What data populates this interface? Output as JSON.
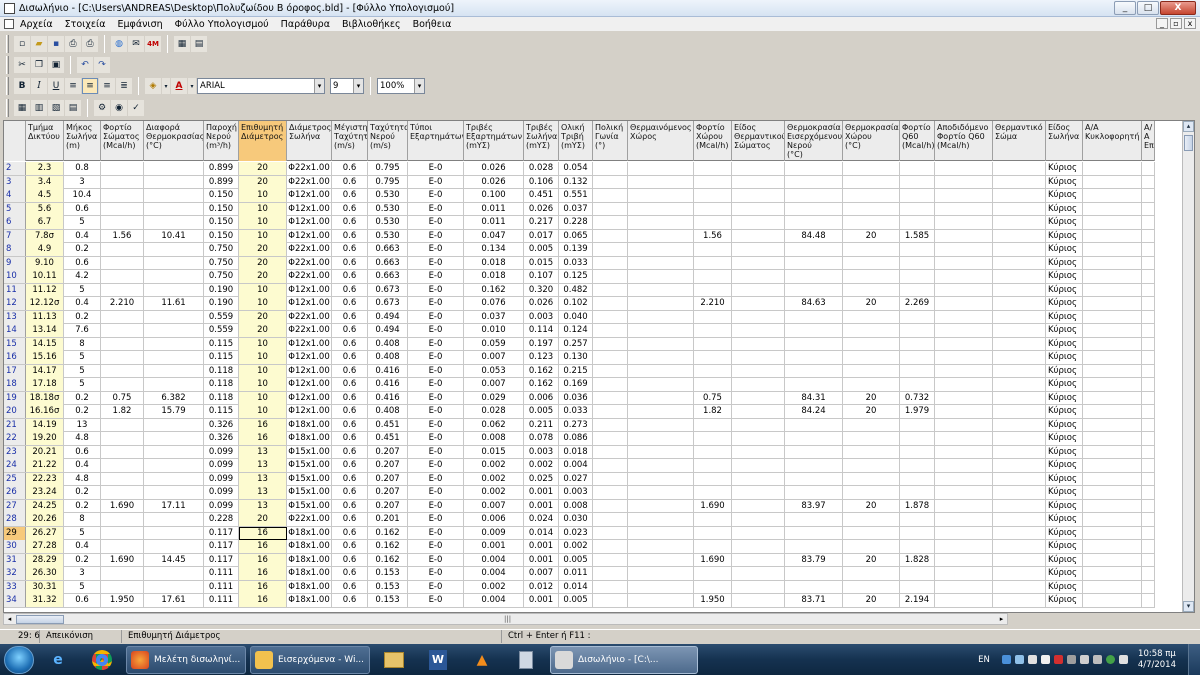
{
  "window": {
    "title": "Δισωλήνιο - [C:\\Users\\ANDREAS\\Desktop\\Πολυζωίδου Β όροφος.bld] - [Φύλλο Υπολογισμού]",
    "minimize_label": "_",
    "maximize_label": "□",
    "close_label": "X"
  },
  "menu": {
    "items": [
      "Αρχεία",
      "Στοιχεία",
      "Εμφάνιση",
      "Φύλλο Υπολογισμού",
      "Παράθυρα",
      "Βιβλιοθήκες",
      "Βοήθεια"
    ]
  },
  "format_toolbar": {
    "bold_label": "B",
    "italic_label": "I",
    "underline_label": "U",
    "font_value": "ARIAL",
    "size_value": "9",
    "zoom_value": "100%",
    "font_color_label": "A"
  },
  "grid": {
    "selected_column": "Επιθυμητή Διάμετρος",
    "current_cell": {
      "row": "29",
      "col": "Επιθυμητή Διάμετρος"
    },
    "columns": [
      "Τμήμα\nΔικτύου",
      "Μήκος\nΣωλήνα\n(m)",
      "Φορτίο\nΣώματος\n(Mcal/h)",
      "Διαφορά\nΘερμοκρασίας\n(°C)",
      "Παροχή\nΝερού\n(m³/h)",
      "Επιθυμητή\nΔιάμετρος",
      "Διάμετρος\nΣωλήνα",
      "Μέγιστη\nΤαχύτητα\n(m/s)",
      "Ταχύτητα\nΝερού\n(m/s)",
      "Τύποι\nΕξαρτημάτων",
      "Τριβές\nΕξαρτημάτων\n(mΥΣ)",
      "Τριβές\nΣωλήνα\n(mΥΣ)",
      "Ολική\nΤριβή\n(mΥΣ)",
      "Πολική\nΓωνία\n(°)",
      "Θερμαινόμενος\nΧώρος",
      "Φορτίο\nΧώρου\n(Mcal/h)",
      "Είδος\nΘερμαντικού\nΣώματος",
      "Θερμοκρασία\nΕισερχόμενου\nΝερού\n(°C)",
      "Θερμοκρασία\nΧώρου\n(°C)",
      "Φορτίο\nQ60\n(Mcal/h)",
      "Αποδιδόμενο\nΦορτίο Q60\n(Mcal/h)",
      "Θερμαντικό\nΣώμα",
      "Είδος\nΣωλήνα",
      "Α/Α\nΚυκλοφορητή",
      "Α/Α\nΕπ"
    ],
    "rows": [
      {
        "n": "2",
        "d": [
          "2.3",
          "0.8",
          "",
          "",
          "0.899",
          "20",
          "Φ22x1.00",
          "0.6",
          "0.795",
          "E-0",
          "0.026",
          "0.028",
          "0.054",
          "",
          "",
          "",
          "",
          "",
          "",
          "",
          "",
          "",
          "Κύριος",
          "",
          ""
        ]
      },
      {
        "n": "3",
        "d": [
          "3.4",
          "3",
          "",
          "",
          "0.899",
          "20",
          "Φ22x1.00",
          "0.6",
          "0.795",
          "E-0",
          "0.026",
          "0.106",
          "0.132",
          "",
          "",
          "",
          "",
          "",
          "",
          "",
          "",
          "",
          "Κύριος",
          "",
          ""
        ]
      },
      {
        "n": "4",
        "d": [
          "4.5",
          "10.4",
          "",
          "",
          "0.150",
          "10",
          "Φ12x1.00",
          "0.6",
          "0.530",
          "E-0",
          "0.100",
          "0.451",
          "0.551",
          "",
          "",
          "",
          "",
          "",
          "",
          "",
          "",
          "",
          "Κύριος",
          "",
          ""
        ]
      },
      {
        "n": "5",
        "d": [
          "5.6",
          "0.6",
          "",
          "",
          "0.150",
          "10",
          "Φ12x1.00",
          "0.6",
          "0.530",
          "E-0",
          "0.011",
          "0.026",
          "0.037",
          "",
          "",
          "",
          "",
          "",
          "",
          "",
          "",
          "",
          "Κύριος",
          "",
          ""
        ]
      },
      {
        "n": "6",
        "d": [
          "6.7",
          "5",
          "",
          "",
          "0.150",
          "10",
          "Φ12x1.00",
          "0.6",
          "0.530",
          "E-0",
          "0.011",
          "0.217",
          "0.228",
          "",
          "",
          "",
          "",
          "",
          "",
          "",
          "",
          "",
          "Κύριος",
          "",
          ""
        ]
      },
      {
        "n": "7",
        "d": [
          "7.8σ",
          "0.4",
          "1.56",
          "10.41",
          "0.150",
          "10",
          "Φ12x1.00",
          "0.6",
          "0.530",
          "E-0",
          "0.047",
          "0.017",
          "0.065",
          "",
          "",
          "1.56",
          "",
          "84.48",
          "20",
          "1.585",
          "",
          "",
          "Κύριος",
          "",
          ""
        ]
      },
      {
        "n": "8",
        "d": [
          "4.9",
          "0.2",
          "",
          "",
          "0.750",
          "20",
          "Φ22x1.00",
          "0.6",
          "0.663",
          "E-0",
          "0.134",
          "0.005",
          "0.139",
          "",
          "",
          "",
          "",
          "",
          "",
          "",
          "",
          "",
          "Κύριος",
          "",
          ""
        ]
      },
      {
        "n": "9",
        "d": [
          "9.10",
          "0.6",
          "",
          "",
          "0.750",
          "20",
          "Φ22x1.00",
          "0.6",
          "0.663",
          "E-0",
          "0.018",
          "0.015",
          "0.033",
          "",
          "",
          "",
          "",
          "",
          "",
          "",
          "",
          "",
          "Κύριος",
          "",
          ""
        ]
      },
      {
        "n": "10",
        "d": [
          "10.11",
          "4.2",
          "",
          "",
          "0.750",
          "20",
          "Φ22x1.00",
          "0.6",
          "0.663",
          "E-0",
          "0.018",
          "0.107",
          "0.125",
          "",
          "",
          "",
          "",
          "",
          "",
          "",
          "",
          "",
          "Κύριος",
          "",
          ""
        ]
      },
      {
        "n": "11",
        "d": [
          "11.12",
          "5",
          "",
          "",
          "0.190",
          "10",
          "Φ12x1.00",
          "0.6",
          "0.673",
          "E-0",
          "0.162",
          "0.320",
          "0.482",
          "",
          "",
          "",
          "",
          "",
          "",
          "",
          "",
          "",
          "Κύριος",
          "",
          ""
        ]
      },
      {
        "n": "12",
        "d": [
          "12.12σ",
          "0.4",
          "2.210",
          "11.61",
          "0.190",
          "10",
          "Φ12x1.00",
          "0.6",
          "0.673",
          "E-0",
          "0.076",
          "0.026",
          "0.102",
          "",
          "",
          "2.210",
          "",
          "84.63",
          "20",
          "2.269",
          "",
          "",
          "Κύριος",
          "",
          ""
        ]
      },
      {
        "n": "13",
        "d": [
          "11.13",
          "0.2",
          "",
          "",
          "0.559",
          "20",
          "Φ22x1.00",
          "0.6",
          "0.494",
          "E-0",
          "0.037",
          "0.003",
          "0.040",
          "",
          "",
          "",
          "",
          "",
          "",
          "",
          "",
          "",
          "Κύριος",
          "",
          ""
        ]
      },
      {
        "n": "14",
        "d": [
          "13.14",
          "7.6",
          "",
          "",
          "0.559",
          "20",
          "Φ22x1.00",
          "0.6",
          "0.494",
          "E-0",
          "0.010",
          "0.114",
          "0.124",
          "",
          "",
          "",
          "",
          "",
          "",
          "",
          "",
          "",
          "Κύριος",
          "",
          ""
        ]
      },
      {
        "n": "15",
        "d": [
          "14.15",
          "8",
          "",
          "",
          "0.115",
          "10",
          "Φ12x1.00",
          "0.6",
          "0.408",
          "E-0",
          "0.059",
          "0.197",
          "0.257",
          "",
          "",
          "",
          "",
          "",
          "",
          "",
          "",
          "",
          "Κύριος",
          "",
          ""
        ]
      },
      {
        "n": "16",
        "d": [
          "15.16",
          "5",
          "",
          "",
          "0.115",
          "10",
          "Φ12x1.00",
          "0.6",
          "0.408",
          "E-0",
          "0.007",
          "0.123",
          "0.130",
          "",
          "",
          "",
          "",
          "",
          "",
          "",
          "",
          "",
          "Κύριος",
          "",
          ""
        ]
      },
      {
        "n": "17",
        "d": [
          "14.17",
          "5",
          "",
          "",
          "0.118",
          "10",
          "Φ12x1.00",
          "0.6",
          "0.416",
          "E-0",
          "0.053",
          "0.162",
          "0.215",
          "",
          "",
          "",
          "",
          "",
          "",
          "",
          "",
          "",
          "Κύριος",
          "",
          ""
        ]
      },
      {
        "n": "18",
        "d": [
          "17.18",
          "5",
          "",
          "",
          "0.118",
          "10",
          "Φ12x1.00",
          "0.6",
          "0.416",
          "E-0",
          "0.007",
          "0.162",
          "0.169",
          "",
          "",
          "",
          "",
          "",
          "",
          "",
          "",
          "",
          "Κύριος",
          "",
          ""
        ]
      },
      {
        "n": "19",
        "d": [
          "18.18σ",
          "0.2",
          "0.75",
          "6.382",
          "0.118",
          "10",
          "Φ12x1.00",
          "0.6",
          "0.416",
          "E-0",
          "0.029",
          "0.006",
          "0.036",
          "",
          "",
          "0.75",
          "",
          "84.31",
          "20",
          "0.732",
          "",
          "",
          "Κύριος",
          "",
          ""
        ]
      },
      {
        "n": "20",
        "d": [
          "16.16σ",
          "0.2",
          "1.82",
          "15.79",
          "0.115",
          "10",
          "Φ12x1.00",
          "0.6",
          "0.408",
          "E-0",
          "0.028",
          "0.005",
          "0.033",
          "",
          "",
          "1.82",
          "",
          "84.24",
          "20",
          "1.979",
          "",
          "",
          "Κύριος",
          "",
          ""
        ]
      },
      {
        "n": "21",
        "d": [
          "14.19",
          "13",
          "",
          "",
          "0.326",
          "16",
          "Φ18x1.00",
          "0.6",
          "0.451",
          "E-0",
          "0.062",
          "0.211",
          "0.273",
          "",
          "",
          "",
          "",
          "",
          "",
          "",
          "",
          "",
          "Κύριος",
          "",
          ""
        ]
      },
      {
        "n": "22",
        "d": [
          "19.20",
          "4.8",
          "",
          "",
          "0.326",
          "16",
          "Φ18x1.00",
          "0.6",
          "0.451",
          "E-0",
          "0.008",
          "0.078",
          "0.086",
          "",
          "",
          "",
          "",
          "",
          "",
          "",
          "",
          "",
          "Κύριος",
          "",
          ""
        ]
      },
      {
        "n": "23",
        "d": [
          "20.21",
          "0.6",
          "",
          "",
          "0.099",
          "13",
          "Φ15x1.00",
          "0.6",
          "0.207",
          "E-0",
          "0.015",
          "0.003",
          "0.018",
          "",
          "",
          "",
          "",
          "",
          "",
          "",
          "",
          "",
          "Κύριος",
          "",
          ""
        ]
      },
      {
        "n": "24",
        "d": [
          "21.22",
          "0.4",
          "",
          "",
          "0.099",
          "13",
          "Φ15x1.00",
          "0.6",
          "0.207",
          "E-0",
          "0.002",
          "0.002",
          "0.004",
          "",
          "",
          "",
          "",
          "",
          "",
          "",
          "",
          "",
          "Κύριος",
          "",
          ""
        ]
      },
      {
        "n": "25",
        "d": [
          "22.23",
          "4.8",
          "",
          "",
          "0.099",
          "13",
          "Φ15x1.00",
          "0.6",
          "0.207",
          "E-0",
          "0.002",
          "0.025",
          "0.027",
          "",
          "",
          "",
          "",
          "",
          "",
          "",
          "",
          "",
          "Κύριος",
          "",
          ""
        ]
      },
      {
        "n": "26",
        "d": [
          "23.24",
          "0.2",
          "",
          "",
          "0.099",
          "13",
          "Φ15x1.00",
          "0.6",
          "0.207",
          "E-0",
          "0.002",
          "0.001",
          "0.003",
          "",
          "",
          "",
          "",
          "",
          "",
          "",
          "",
          "",
          "Κύριος",
          "",
          ""
        ]
      },
      {
        "n": "27",
        "d": [
          "24.25",
          "0.2",
          "1.690",
          "17.11",
          "0.099",
          "13",
          "Φ15x1.00",
          "0.6",
          "0.207",
          "E-0",
          "0.007",
          "0.001",
          "0.008",
          "",
          "",
          "1.690",
          "",
          "83.97",
          "20",
          "1.878",
          "",
          "",
          "Κύριος",
          "",
          ""
        ]
      },
      {
        "n": "28",
        "d": [
          "20.26",
          "8",
          "",
          "",
          "0.228",
          "20",
          "Φ22x1.00",
          "0.6",
          "0.201",
          "E-0",
          "0.006",
          "0.024",
          "0.030",
          "",
          "",
          "",
          "",
          "",
          "",
          "",
          "",
          "",
          "Κύριος",
          "",
          ""
        ]
      },
      {
        "n": "29",
        "d": [
          "26.27",
          "5",
          "",
          "",
          "0.117",
          "16",
          "Φ18x1.00",
          "0.6",
          "0.162",
          "E-0",
          "0.009",
          "0.014",
          "0.023",
          "",
          "",
          "",
          "",
          "",
          "",
          "",
          "",
          "",
          "Κύριος",
          "",
          ""
        ]
      },
      {
        "n": "30",
        "d": [
          "27.28",
          "0.4",
          "",
          "",
          "0.117",
          "16",
          "Φ18x1.00",
          "0.6",
          "0.162",
          "E-0",
          "0.001",
          "0.001",
          "0.002",
          "",
          "",
          "",
          "",
          "",
          "",
          "",
          "",
          "",
          "Κύριος",
          "",
          ""
        ]
      },
      {
        "n": "31",
        "d": [
          "28.29",
          "0.2",
          "1.690",
          "14.45",
          "0.117",
          "16",
          "Φ18x1.00",
          "0.6",
          "0.162",
          "E-0",
          "0.004",
          "0.001",
          "0.005",
          "",
          "",
          "1.690",
          "",
          "83.79",
          "20",
          "1.828",
          "",
          "",
          "Κύριος",
          "",
          ""
        ]
      },
      {
        "n": "32",
        "d": [
          "26.30",
          "3",
          "",
          "",
          "0.111",
          "16",
          "Φ18x1.00",
          "0.6",
          "0.153",
          "E-0",
          "0.004",
          "0.007",
          "0.011",
          "",
          "",
          "",
          "",
          "",
          "",
          "",
          "",
          "",
          "Κύριος",
          "",
          ""
        ]
      },
      {
        "n": "33",
        "d": [
          "30.31",
          "5",
          "",
          "",
          "0.111",
          "16",
          "Φ18x1.00",
          "0.6",
          "0.153",
          "E-0",
          "0.002",
          "0.012",
          "0.014",
          "",
          "",
          "",
          "",
          "",
          "",
          "",
          "",
          "",
          "Κύριος",
          "",
          ""
        ]
      },
      {
        "n": "34",
        "d": [
          "31.32",
          "0.6",
          "1.950",
          "17.61",
          "0.111",
          "16",
          "Φ18x1.00",
          "0.6",
          "0.153",
          "E-0",
          "0.004",
          "0.001",
          "0.005",
          "",
          "",
          "1.950",
          "",
          "83.71",
          "20",
          "2.194",
          "",
          "",
          "Κύριος",
          "",
          ""
        ]
      }
    ]
  },
  "statusbar": {
    "position": "29: 6",
    "mode": "Απεικόνιση",
    "field": "Επιθυμητή Διάμετρος",
    "hint": "Ctrl + Enter ή F11 :"
  },
  "taskbar": {
    "tasks": [
      {
        "label": "Μελέτη δισωληνί...",
        "color": "#e8702a"
      },
      {
        "label": "Εισερχόμενα - Wi...",
        "color": "#f2c14e"
      },
      {
        "label": "Δισωλήνιο - [C:\\...",
        "color": "#d9d9d9"
      }
    ],
    "language": "EN",
    "time": "10:58 πμ",
    "date": "4/7/2014"
  }
}
